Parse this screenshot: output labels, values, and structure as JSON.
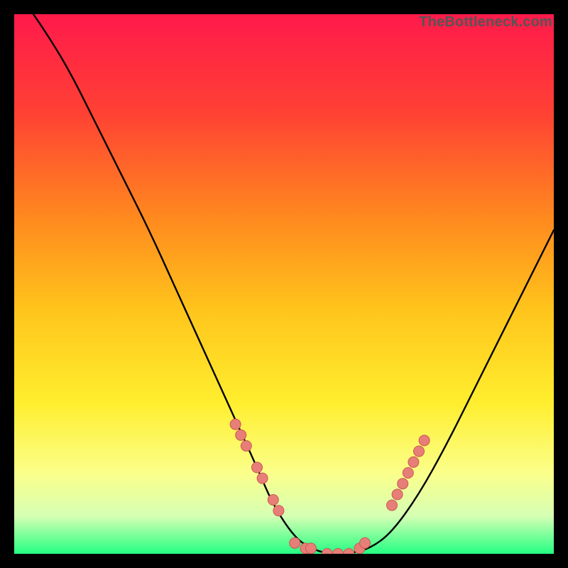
{
  "watermark": "TheBottleneck.com",
  "colors": {
    "background": "#000000",
    "gradient_top": "#ff1a4b",
    "gradient_mid1": "#ff6e26",
    "gradient_mid2": "#ffd21f",
    "gradient_mid3": "#ffff55",
    "gradient_low": "#f4ffb0",
    "gradient_bottom": "#24ff82",
    "curve": "#000000",
    "dot_fill": "#e77e77",
    "dot_stroke": "#c95952"
  },
  "chart_data": {
    "type": "line",
    "title": "",
    "xlabel": "",
    "ylabel": "",
    "xlim": [
      0,
      100
    ],
    "ylim": [
      0,
      100
    ],
    "series": [
      {
        "name": "bottleneck-curve",
        "x": [
          0,
          5,
          10,
          15,
          20,
          25,
          30,
          35,
          40,
          45,
          48,
          52,
          55,
          58,
          62,
          66,
          70,
          75,
          80,
          85,
          90,
          95,
          100
        ],
        "y": [
          105,
          98,
          90,
          80,
          70,
          60,
          49,
          38,
          27,
          16,
          9,
          3,
          1,
          0,
          0,
          1,
          4,
          11,
          20,
          30,
          40,
          50,
          60
        ]
      }
    ],
    "markers": {
      "name": "highlighted-points",
      "left_branch": [
        {
          "x": 41,
          "y": 24
        },
        {
          "x": 42,
          "y": 22
        },
        {
          "x": 43,
          "y": 20
        },
        {
          "x": 45,
          "y": 16
        },
        {
          "x": 46,
          "y": 14
        },
        {
          "x": 48,
          "y": 10
        },
        {
          "x": 49,
          "y": 8
        }
      ],
      "bottom": [
        {
          "x": 52,
          "y": 2
        },
        {
          "x": 54,
          "y": 1
        },
        {
          "x": 55,
          "y": 1
        },
        {
          "x": 58,
          "y": 0
        },
        {
          "x": 60,
          "y": 0
        },
        {
          "x": 62,
          "y": 0
        },
        {
          "x": 64,
          "y": 1
        },
        {
          "x": 65,
          "y": 2
        }
      ],
      "right_branch": [
        {
          "x": 70,
          "y": 9
        },
        {
          "x": 71,
          "y": 11
        },
        {
          "x": 72,
          "y": 13
        },
        {
          "x": 73,
          "y": 15
        },
        {
          "x": 74,
          "y": 17
        },
        {
          "x": 75,
          "y": 19
        },
        {
          "x": 76,
          "y": 21
        }
      ]
    }
  }
}
